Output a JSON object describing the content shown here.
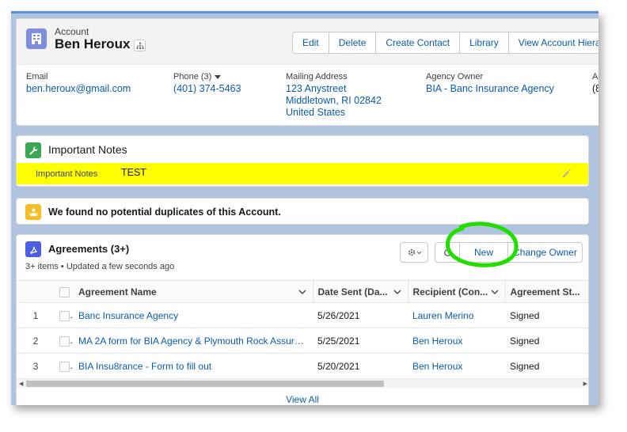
{
  "header": {
    "object_label": "Account",
    "record_name": "Ben Heroux",
    "actions": [
      "Edit",
      "Delete",
      "Create Contact",
      "Library",
      "View Account Hiera"
    ],
    "fields": {
      "email_label": "Email",
      "email_value": "ben.heroux@gmail.com",
      "phone_label": "Phone (3)",
      "phone_value": "(401) 374-5463",
      "address_label": "Mailing Address",
      "address_line1": "123 Anystreet",
      "address_line2": "Middletown, RI 02842",
      "address_line3": "United States",
      "agency_label": "Agency Owner",
      "agency_value": "BIA - Banc Insurance Agency",
      "cutoff_label": "A",
      "cutoff_value": "(8"
    }
  },
  "notes": {
    "title": "Important Notes",
    "field_label": "Important Notes",
    "field_value": "TEST"
  },
  "duplicates": {
    "message": "We found no potential duplicates of this Account."
  },
  "agreements": {
    "title": "Agreements (3+)",
    "subtitle": "3+ items • Updated a few seconds ago",
    "new_label": "New",
    "change_owner_label": "Change Owner",
    "columns": [
      "Agreement Name",
      "Date Sent (Da...",
      "Recipient (Con...",
      "Agreement St..."
    ],
    "rows": [
      {
        "num": "1",
        "name": "Banc Insurance Agency",
        "date": "5/26/2021",
        "recipient": "Lauren Merino",
        "status": "Signed"
      },
      {
        "num": "2",
        "name": "MA 2A form for BIA Agency & Plymouth Rock Assuranc...",
        "date": "5/25/2021",
        "recipient": "Ben Heroux",
        "status": "Signed"
      },
      {
        "num": "3",
        "name": "BIA Insu8rance - Form to fill out",
        "date": "5/20/2021",
        "recipient": "Ben Heroux",
        "status": "Signed"
      }
    ],
    "view_all": "View All"
  },
  "colors": {
    "brand_link": "#0b5cab",
    "account_icon": "#7f8de1",
    "notes_icon": "#3ba755",
    "duplicates_icon": "#f4bc25",
    "agreements_icon": "#4c5ee4",
    "highlight": "#ffff00",
    "annotation": "#22dd00"
  },
  "icons": [
    "account-icon",
    "hierarchy-icon",
    "wrench-icon",
    "pencil-icon",
    "duplicate-icon",
    "agreement-icon",
    "gear-icon",
    "refresh-icon",
    "chevron-down-icon"
  ]
}
